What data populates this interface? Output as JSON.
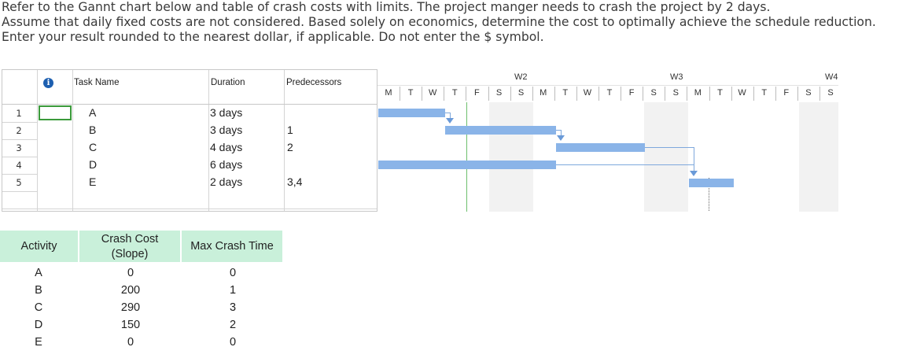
{
  "question": {
    "lines": [
      "Refer to the Gannt chart below and table of crash costs with limits.  The project manger needs to crash the project by 2 days.",
      "Assume that daily fixed costs are not considered.  Based solely on economics, determine the cost to optimally achieve the schedule reduction.",
      "Enter your result rounded to the nearest dollar, if applicable.  Do not enter the $ symbol."
    ]
  },
  "gantt": {
    "headers": {
      "info_icon": "i",
      "task_name": "Task Name",
      "duration": "Duration",
      "predecessors": "Predecessors"
    },
    "rows": [
      {
        "num": "1",
        "task": "A",
        "duration": "3 days",
        "pred": ""
      },
      {
        "num": "2",
        "task": "B",
        "duration": "3 days",
        "pred": "1"
      },
      {
        "num": "3",
        "task": "C",
        "duration": "4 days",
        "pred": "2"
      },
      {
        "num": "4",
        "task": "D",
        "duration": "6 days",
        "pred": ""
      },
      {
        "num": "5",
        "task": "E",
        "duration": "2 days",
        "pred": "3,4"
      }
    ],
    "timeline": {
      "weeks": [
        "W2",
        "W3",
        "W4"
      ],
      "days": [
        "M",
        "T",
        "W",
        "T",
        "F",
        "S",
        "S",
        "M",
        "T",
        "W",
        "T",
        "F",
        "S",
        "S",
        "M",
        "T",
        "W",
        "T",
        "F",
        "S",
        "S"
      ]
    },
    "colors": {
      "bar": "#8ab4e8",
      "today_line": "#6cbf6c",
      "selection_border": "#3b9a3b"
    }
  },
  "crash_table": {
    "headers": {
      "activity": "Activity",
      "crash_cost": "Crash Cost (Slope)",
      "max_crash_time": "Max Crash Time"
    },
    "rows": [
      {
        "activity": "A",
        "crash_cost": "0",
        "max_crash_time": "0"
      },
      {
        "activity": "B",
        "crash_cost": "200",
        "max_crash_time": "1"
      },
      {
        "activity": "C",
        "crash_cost": "290",
        "max_crash_time": "3"
      },
      {
        "activity": "D",
        "crash_cost": "150",
        "max_crash_time": "2"
      },
      {
        "activity": "E",
        "crash_cost": "0",
        "max_crash_time": "0"
      }
    ],
    "colors": {
      "header_bg": "#c9f0da"
    }
  }
}
